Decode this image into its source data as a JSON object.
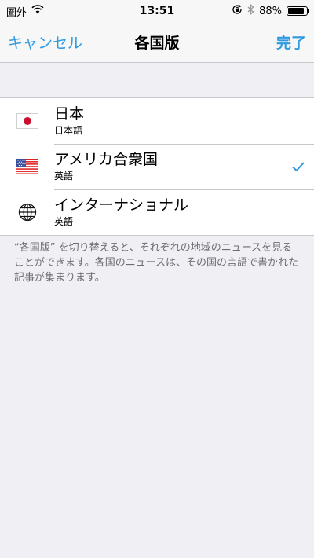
{
  "status_bar": {
    "carrier": "圏外",
    "time": "13:51",
    "battery_percent": "88%",
    "battery_level": 0.88,
    "icons": [
      "wifi-icon",
      "rotation-lock-icon",
      "bluetooth-icon",
      "battery-icon"
    ]
  },
  "nav": {
    "cancel_label": "キャンセル",
    "title": "各国版",
    "done_label": "完了"
  },
  "editions": [
    {
      "title": "日本",
      "subtitle": "日本語",
      "icon": "japan-flag-icon",
      "selected": false
    },
    {
      "title": "アメリカ合衆国",
      "subtitle": "英語",
      "icon": "us-flag-icon",
      "selected": true
    },
    {
      "title": "インターナショナル",
      "subtitle": "英語",
      "icon": "globe-icon",
      "selected": false
    }
  ],
  "footer_note": "“各国版” を切り替えると、それぞれの地域のニュースを見ることができます。各国のニュースは、その国の言語で書かれた記事が集まります。",
  "colors": {
    "accent": "#2f9ae0",
    "background": "#efeff4",
    "separator": "#c8c7cc",
    "footer_text": "#6d6d72"
  }
}
